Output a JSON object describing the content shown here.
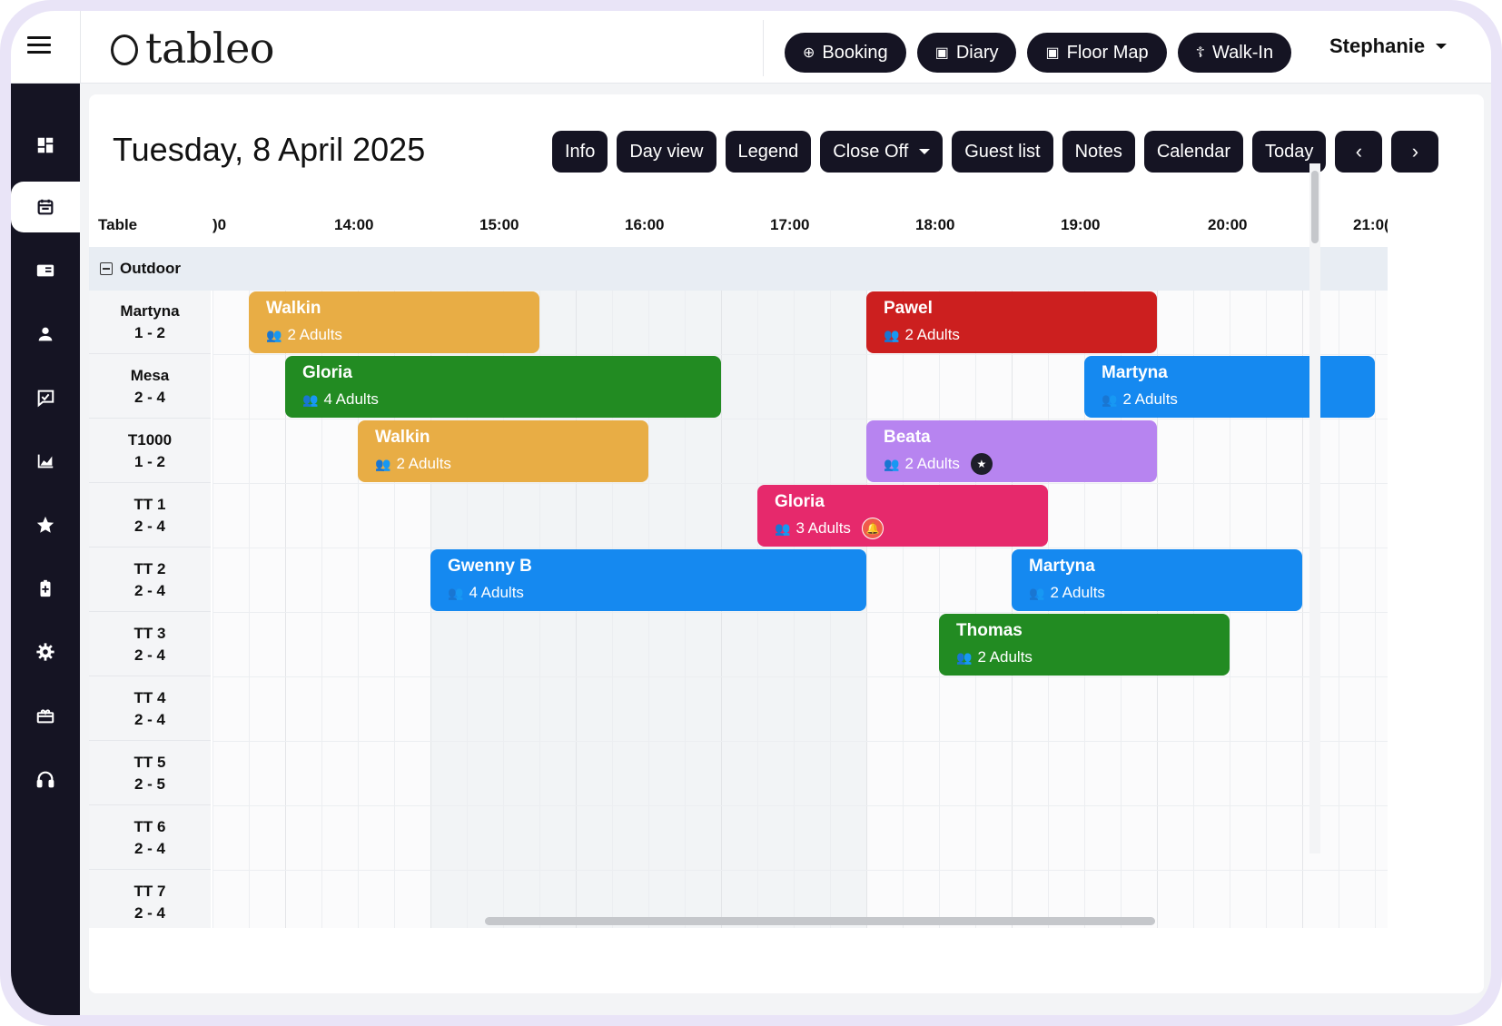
{
  "app": {
    "logo_text": "tableo",
    "user_name": "Stephanie"
  },
  "top_buttons": [
    {
      "label": "Booking",
      "icon": "plus-circle-icon"
    },
    {
      "label": "Diary",
      "icon": "calendar-icon"
    },
    {
      "label": "Floor Map",
      "icon": "map-icon"
    },
    {
      "label": "Walk-In",
      "icon": "walking-icon"
    }
  ],
  "sidebar": [
    {
      "name": "dashboard-icon"
    },
    {
      "name": "calendar-icon",
      "active": true
    },
    {
      "name": "book-icon"
    },
    {
      "name": "user-icon"
    },
    {
      "name": "check-message-icon"
    },
    {
      "name": "chart-icon"
    },
    {
      "name": "star-icon"
    },
    {
      "name": "battery-icon"
    },
    {
      "name": "gear-icon"
    },
    {
      "name": "gift-icon"
    },
    {
      "name": "headphones-icon"
    }
  ],
  "page": {
    "date_title": "Tuesday, 8 April 2025"
  },
  "toolbar": {
    "info": "Info",
    "day_view": "Day view",
    "legend": "Legend",
    "close_off": "Close Off",
    "guest_list": "Guest list",
    "notes": "Notes",
    "calendar": "Calendar",
    "today": "Today",
    "prev": "‹",
    "next": "›"
  },
  "grid": {
    "table_header": "Table",
    "times": [
      ")0",
      "14:00",
      "15:00",
      "16:00",
      "17:00",
      "18:00",
      "19:00",
      "20:00",
      "21:0("
    ],
    "group": "Outdoor",
    "rows": [
      {
        "name": "Martyna",
        "cap": "1 - 2"
      },
      {
        "name": "Mesa",
        "cap": "2 - 4"
      },
      {
        "name": "T1000",
        "cap": "1 - 2"
      },
      {
        "name": "TT 1",
        "cap": "2 - 4"
      },
      {
        "name": "TT 2",
        "cap": "2 - 4"
      },
      {
        "name": "TT 3",
        "cap": "2 - 4"
      },
      {
        "name": "TT 4",
        "cap": "2 - 4"
      },
      {
        "name": "TT 5",
        "cap": "2 - 5"
      },
      {
        "name": "TT 6",
        "cap": "2 - 4"
      },
      {
        "name": "TT 7",
        "cap": "2 - 4"
      }
    ]
  },
  "bookings": [
    {
      "name": "Walkin",
      "guests": "2 Adults",
      "row": 0,
      "start": "13:45",
      "end": "15:45",
      "color": "#e8ad45"
    },
    {
      "name": "Pawel",
      "guests": "2 Adults",
      "row": 0,
      "start": "18:00",
      "end": "20:00",
      "color": "#cc1f1f"
    },
    {
      "name": "Gloria",
      "guests": "4 Adults",
      "row": 1,
      "start": "14:00",
      "end": "17:00",
      "color": "#228b22"
    },
    {
      "name": "Martyna",
      "guests": "2 Adults",
      "row": 1,
      "start": "19:30",
      "end": "21:30",
      "color": "#1589f0"
    },
    {
      "name": "Walkin",
      "guests": "2 Adults",
      "row": 2,
      "start": "14:30",
      "end": "16:30",
      "color": "#e8ad45"
    },
    {
      "name": "Beata",
      "guests": "2 Adults",
      "row": 2,
      "start": "18:00",
      "end": "20:00",
      "color": "#b784f0",
      "badge": "star-icon",
      "badge_color": "#1e1e2a"
    },
    {
      "name": "Gloria",
      "guests": "3 Adults",
      "row": 3,
      "start": "17:15",
      "end": "19:15",
      "color": "#e6296c",
      "badge": "bell-icon",
      "badge_color": "#f05a4a"
    },
    {
      "name": "Gwenny B",
      "guests": "4 Adults",
      "row": 4,
      "start": "15:00",
      "end": "18:00",
      "color": "#1589f0"
    },
    {
      "name": "Martyna",
      "guests": "2 Adults",
      "row": 4,
      "start": "19:00",
      "end": "21:00",
      "color": "#1589f0"
    },
    {
      "name": "Thomas",
      "guests": "2 Adults",
      "row": 5,
      "start": "18:30",
      "end": "20:30",
      "color": "#228b22"
    }
  ]
}
